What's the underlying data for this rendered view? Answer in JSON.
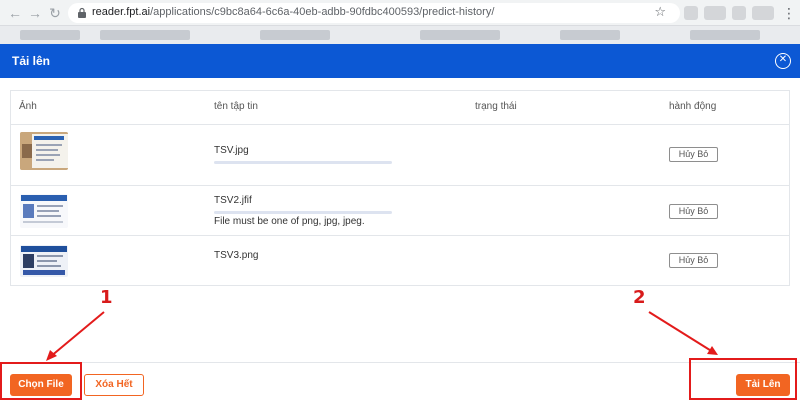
{
  "browser": {
    "url_host": "reader.fpt.ai",
    "url_path": "/applications/c9bc8a64-6c6a-40eb-adbb-90fdbc400593/predict-history/"
  },
  "modal": {
    "title": "Tải lên",
    "columns": [
      "Ảnh",
      "tên tập tin",
      "trạng thái",
      "hành động"
    ],
    "files": [
      {
        "name": "TSV.jpg",
        "error": "",
        "action": "Hủy Bỏ",
        "progress": 1.0
      },
      {
        "name": "TSV2.jfif",
        "error": "File must be one of png, jpg, jpeg.",
        "action": "Hủy Bỏ",
        "progress": 1.0
      },
      {
        "name": "TSV3.png",
        "error": "",
        "action": "Hủy Bỏ",
        "progress": 0
      }
    ],
    "choose_file_label": "Chọn File",
    "clear_all_label": "Xóa Hết",
    "upload_label": "Tải Lên"
  },
  "annotations": {
    "callout_1": "1",
    "callout_2": "2",
    "color": "#e31b1b"
  },
  "colors": {
    "header": "#0c58d4",
    "accent": "#f26522"
  }
}
